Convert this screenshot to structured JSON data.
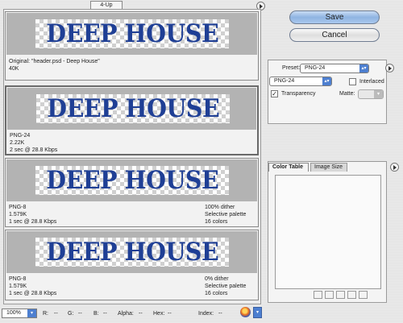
{
  "tabs": {
    "active": "4-Up"
  },
  "previews": [
    {
      "banner": "DEEP HOUSE",
      "info_left": [
        "Original: \"header.psd - Deep House\"",
        "40K"
      ],
      "info_right": []
    },
    {
      "banner": "DEEP HOUSE",
      "info_left": [
        "PNG-24",
        "2.22K",
        "2 sec @ 28.8 Kbps"
      ],
      "info_right": []
    },
    {
      "banner": "DEEP HOUSE",
      "info_left": [
        "PNG-8",
        "1.579K",
        "1 sec @ 28.8 Kbps"
      ],
      "info_right": [
        "100% dither",
        "Selective palette",
        "16 colors"
      ]
    },
    {
      "banner": "DEEP HOUSE",
      "info_left": [
        "PNG-8",
        "1.579K",
        "1 sec @ 28.8 Kbps"
      ],
      "info_right": [
        "0% dither",
        "Selective palette",
        "16 colors"
      ]
    }
  ],
  "buttons": {
    "save": "Save",
    "cancel": "Cancel"
  },
  "settings": {
    "preset_label": "Preset:",
    "preset_value": "PNG-24",
    "format_value": "PNG-24",
    "interlaced_label": "Interlaced",
    "interlaced_checked": false,
    "transparency_label": "Transparency",
    "transparency_checked": true,
    "matte_label": "Matte:"
  },
  "palette_tabs": {
    "color_table": "Color Table",
    "image_size": "Image Size"
  },
  "status": {
    "zoom": "100%",
    "r_label": "R:",
    "r_value": "--",
    "g_label": "G:",
    "g_value": "--",
    "b_label": "B:",
    "b_value": "--",
    "alpha_label": "Alpha:",
    "alpha_value": "--",
    "hex_label": "Hex:",
    "hex_value": "--",
    "index_label": "Index:",
    "index_value": "--"
  },
  "colors": {
    "banner_text": "#1f3f95",
    "accent": "#4d7fd0"
  }
}
